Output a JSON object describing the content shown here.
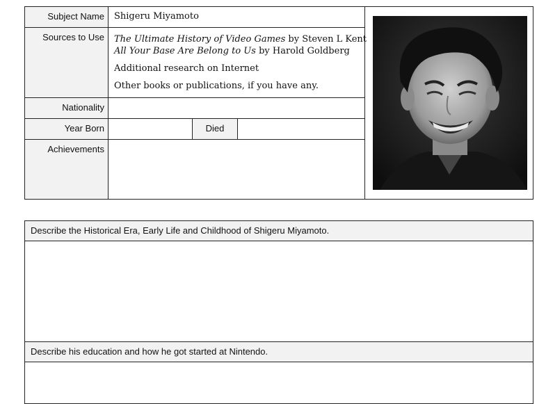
{
  "profile": {
    "subject_label": "Subject Name",
    "subject_value": "Shigeru Miyamoto",
    "sources_label": "Sources to Use",
    "sources": [
      {
        "title": "The Ultimate History of Video Games",
        "author": " by Steven L Kent"
      },
      {
        "title": "All Your Base Are Belong to Us",
        "author": " by Harold Goldberg"
      }
    ],
    "additional": "Additional research on Internet",
    "other": "Other books or publications, if you have any.",
    "nationality_label": "Nationality",
    "year_born_label": "Year Born",
    "died_label": "Died",
    "achievements_label": "Achievements"
  },
  "sections": {
    "early_life": "Describe the Historical Era, Early Life and Childhood of Shigeru Miyamoto.",
    "education": "Describe his education and how he got started at Nintendo."
  },
  "colors": {
    "label_bg": "#f2f2f2",
    "border": "#222222"
  }
}
